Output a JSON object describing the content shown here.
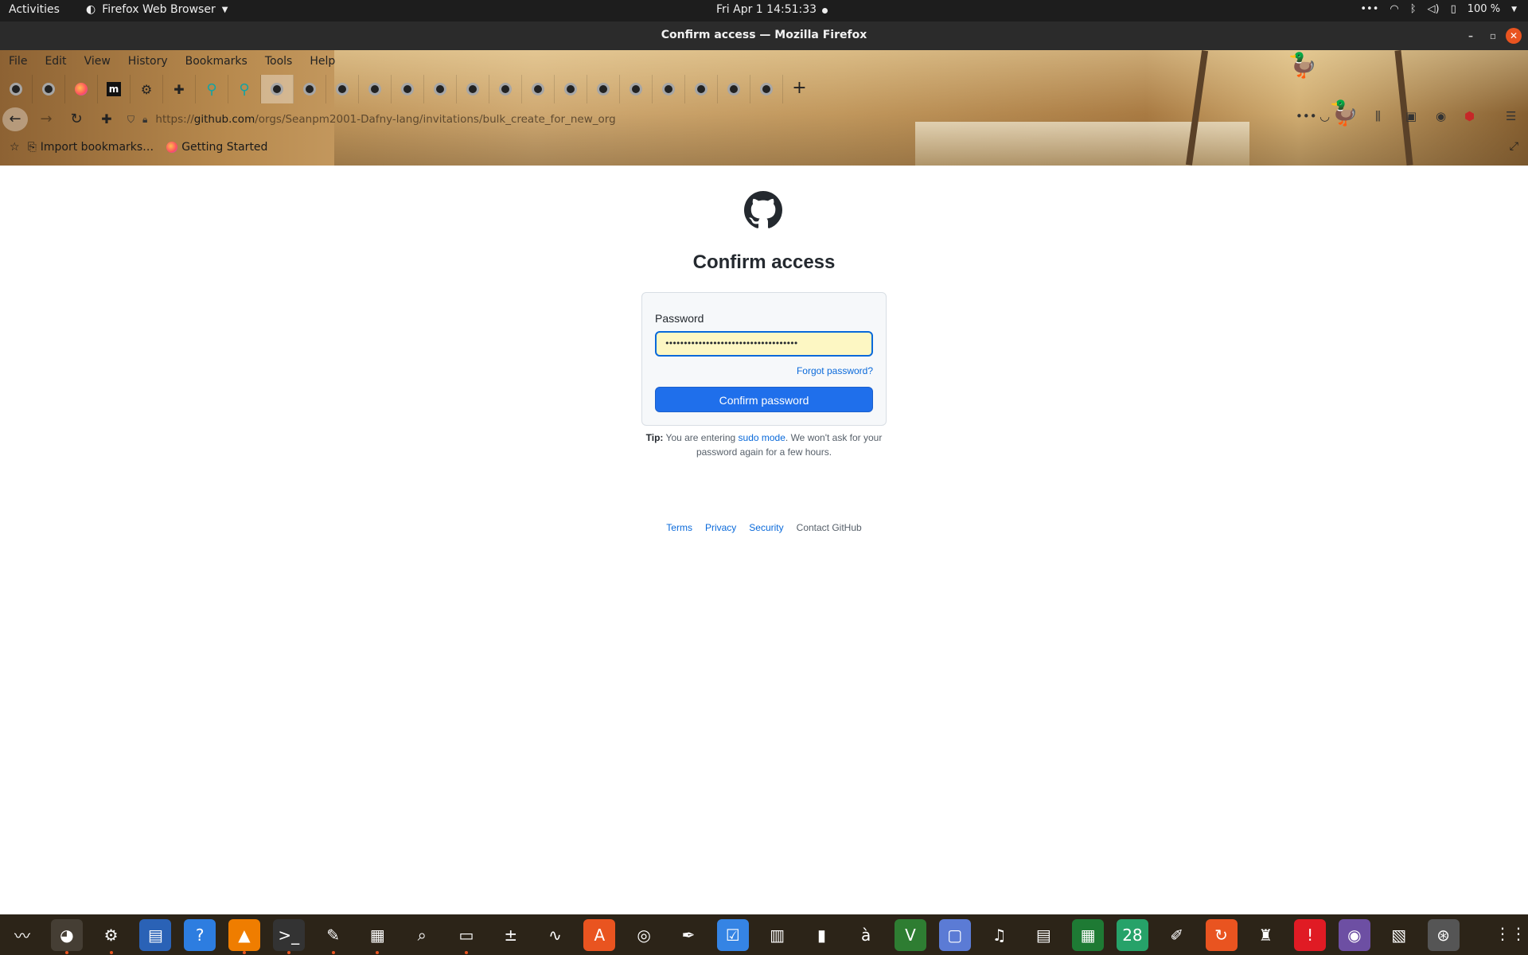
{
  "topbar": {
    "activities": "Activities",
    "app_name": "Firefox Web Browser",
    "clock": "Fri Apr 1  14:51:33",
    "battery": "100 %"
  },
  "window": {
    "title": "Confirm access — Mozilla Firefox"
  },
  "menubar": [
    "File",
    "Edit",
    "View",
    "History",
    "Bookmarks",
    "Tools",
    "Help"
  ],
  "tabs": [
    {
      "icon": "github-icon"
    },
    {
      "icon": "github-icon"
    },
    {
      "icon": "firefox-icon"
    },
    {
      "icon": "m-icon",
      "text": "m"
    },
    {
      "icon": "gear-icon"
    },
    {
      "icon": "puzzle-icon"
    },
    {
      "icon": "teal-icon"
    },
    {
      "icon": "teal-icon"
    },
    {
      "icon": "github-icon",
      "active": true
    },
    {
      "icon": "github-icon"
    },
    {
      "icon": "github-icon"
    },
    {
      "icon": "github-icon"
    },
    {
      "icon": "github-icon"
    },
    {
      "icon": "github-icon"
    },
    {
      "icon": "github-icon"
    },
    {
      "icon": "github-icon"
    },
    {
      "icon": "github-icon"
    },
    {
      "icon": "github-icon"
    },
    {
      "icon": "github-icon"
    },
    {
      "icon": "github-icon"
    },
    {
      "icon": "github-icon"
    },
    {
      "icon": "github-icon"
    },
    {
      "icon": "github-icon"
    },
    {
      "icon": "github-icon"
    }
  ],
  "url": {
    "scheme": "https://",
    "host": "github.com",
    "path": "/orgs/Seanpm2001-Dafny-lang/invitations/bulk_create_for_new_org"
  },
  "bookmarks": {
    "import": "Import bookmarks…",
    "getting_started": "Getting Started"
  },
  "page": {
    "heading": "Confirm access",
    "password_label": "Password",
    "password_value": "••••••••••••••••••••••••••••••••••••",
    "forgot": "Forgot password?",
    "confirm_button": "Confirm password",
    "tip_label": "Tip:",
    "tip_before": "You are entering",
    "tip_link": "sudo mode",
    "tip_after": ". We won't ask for your password again for a few hours.",
    "footer": {
      "terms": "Terms",
      "privacy": "Privacy",
      "security": "Security",
      "contact": "Contact GitHub"
    }
  },
  "dock": [
    "system-monitor-icon",
    "firefox-icon",
    "settings-icon",
    "writer-icon",
    "help-icon",
    "vlc-icon",
    "terminal-icon",
    "text-editor-icon",
    "puzzle-game-icon",
    "image-viewer-icon",
    "files-icon",
    "calculator-icon",
    "sysmon-graph-icon",
    "app-store-icon",
    "disk-utility-icon",
    "inkscape-icon",
    "tasks-icon",
    "presentation-icon",
    "archive-icon",
    "character-map-icon",
    "vim-icon",
    "screen-recorder-icon",
    "music-icon",
    "document-viewer-icon",
    "spreadsheet-icon",
    "calendar-icon",
    "gimp-icon",
    "ubuntu-update-icon",
    "game-icon",
    "alert-icon",
    "camera-icon",
    "pinta-icon",
    "software-updater-icon"
  ],
  "colors": {
    "link": "#0969da",
    "confirm_button": "#1f6feb",
    "password_field_bg": "#fdf7c3",
    "dock_bg": "#2c2418",
    "ubuntu_orange": "#e95420"
  }
}
